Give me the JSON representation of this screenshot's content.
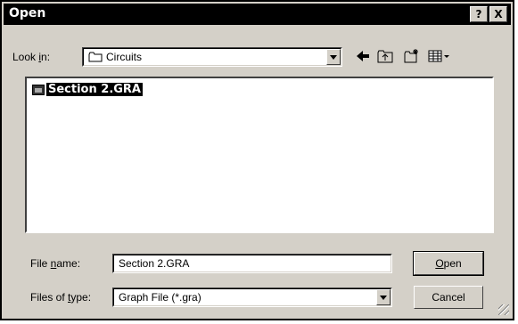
{
  "window": {
    "title": "Open",
    "help_label": "?",
    "close_label": "X"
  },
  "toolbar": {
    "lookin_label_pre": "Look ",
    "lookin_label_key": "i",
    "lookin_label_post": "n:",
    "lookin_value": "Circuits",
    "icons": [
      "back-icon",
      "up-folder-icon",
      "new-folder-icon",
      "view-menu-icon"
    ]
  },
  "files": [
    {
      "name": "Section 2.GRA",
      "icon": "graph-file-icon",
      "selected": true
    }
  ],
  "filename": {
    "label_pre": "File ",
    "label_key": "n",
    "label_post": "ame:",
    "value": "Section 2.GRA"
  },
  "filetype": {
    "label_pre": "Files of ",
    "label_key": "t",
    "label_post": "ype:",
    "value": "Graph File (*.gra)"
  },
  "buttons": {
    "open_key": "O",
    "open_rest": "pen",
    "cancel": "Cancel"
  }
}
